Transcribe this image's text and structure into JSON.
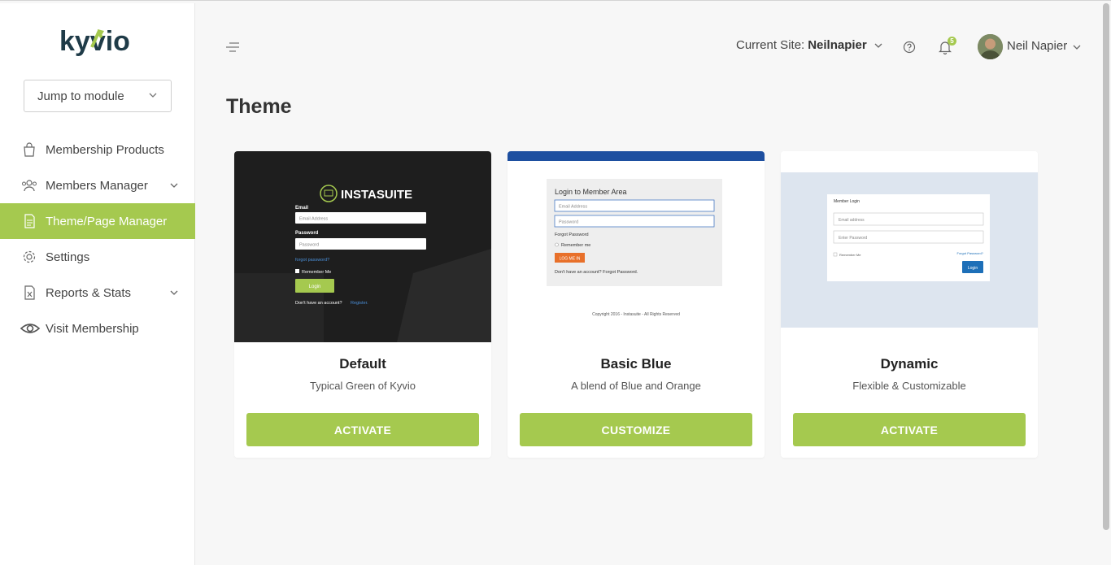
{
  "brand": {
    "logo_text": "kyvio",
    "accent": "#a5c94f"
  },
  "sidebar": {
    "jump_label": "Jump to module",
    "items": [
      {
        "label": "Membership Products",
        "icon": "bag-icon",
        "active": false
      },
      {
        "label": "Members Manager",
        "icon": "users-icon",
        "active": false,
        "expandable": true
      },
      {
        "label": "Theme/Page Manager",
        "icon": "page-icon",
        "active": true
      },
      {
        "label": "Settings",
        "icon": "gear-icon",
        "active": false
      },
      {
        "label": "Reports & Stats",
        "icon": "report-icon",
        "active": false,
        "expandable": true
      },
      {
        "label": "Visit Membership",
        "icon": "eye-icon",
        "active": false
      }
    ]
  },
  "header": {
    "site_label": "Current Site:",
    "site_value": "Neilnapier",
    "notification_count": "5",
    "user_name": "Neil Napier"
  },
  "page": {
    "title": "Theme"
  },
  "themes": [
    {
      "name": "Default",
      "description": "Typical Green of Kyvio",
      "action": "ACTIVATE",
      "preview": {
        "logo": "INSTASUITE",
        "email_label": "Email",
        "email_placeholder": "Email Address",
        "password_label": "Password",
        "password_placeholder": "Password",
        "forgot": "forgot password?",
        "remember": "Remember Me",
        "login": "Login",
        "no_account": "Don't have an account?",
        "register": "Register."
      }
    },
    {
      "name": "Basic Blue",
      "description": "A blend of Blue and Orange",
      "action": "CUSTOMIZE",
      "preview": {
        "title": "Login to Member Area",
        "email_placeholder": "Email Address",
        "password_placeholder": "Password",
        "forgot": "Forgot Password",
        "remember": "Remember me",
        "login": "LOG ME IN",
        "footer_link": "Don't have an account? Forgot Password.",
        "copyright": "Copyright 2016 - Instasuite - All Rights Reserved"
      }
    },
    {
      "name": "Dynamic",
      "description": "Flexible & Customizable",
      "action": "ACTIVATE",
      "preview": {
        "title": "Member Login",
        "email_placeholder": "Email address",
        "password_placeholder": "Enter Password",
        "remember": "Remember Me",
        "forgot": "Forgot Password?",
        "login": "Login"
      }
    }
  ]
}
